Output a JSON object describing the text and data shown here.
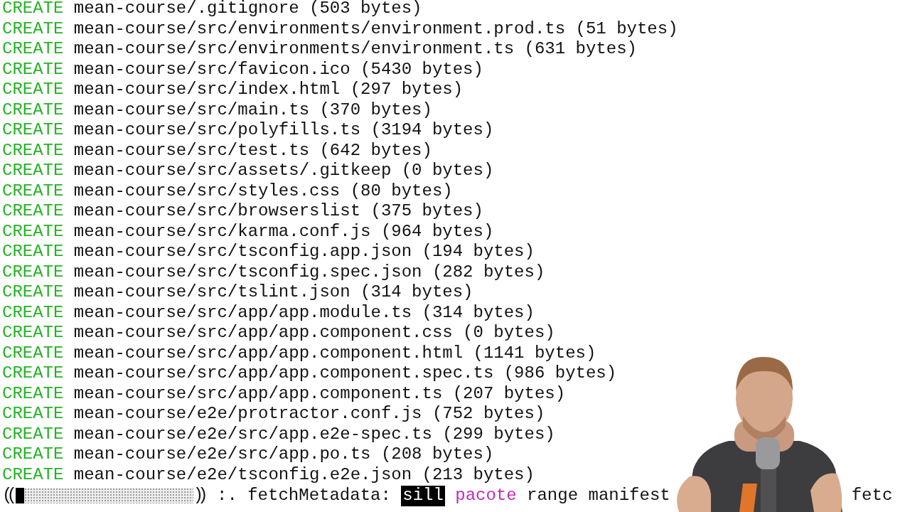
{
  "lines": [
    {
      "keyword": "CREATE",
      "text": "mean-course/.gitignore (503 bytes)"
    },
    {
      "keyword": "CREATE",
      "text": "mean-course/src/environments/environment.prod.ts (51 bytes)"
    },
    {
      "keyword": "CREATE",
      "text": "mean-course/src/environments/environment.ts (631 bytes)"
    },
    {
      "keyword": "CREATE",
      "text": "mean-course/src/favicon.ico (5430 bytes)"
    },
    {
      "keyword": "CREATE",
      "text": "mean-course/src/index.html (297 bytes)"
    },
    {
      "keyword": "CREATE",
      "text": "mean-course/src/main.ts (370 bytes)"
    },
    {
      "keyword": "CREATE",
      "text": "mean-course/src/polyfills.ts (3194 bytes)"
    },
    {
      "keyword": "CREATE",
      "text": "mean-course/src/test.ts (642 bytes)"
    },
    {
      "keyword": "CREATE",
      "text": "mean-course/src/assets/.gitkeep (0 bytes)"
    },
    {
      "keyword": "CREATE",
      "text": "mean-course/src/styles.css (80 bytes)"
    },
    {
      "keyword": "CREATE",
      "text": "mean-course/src/browserslist (375 bytes)"
    },
    {
      "keyword": "CREATE",
      "text": "mean-course/src/karma.conf.js (964 bytes)"
    },
    {
      "keyword": "CREATE",
      "text": "mean-course/src/tsconfig.app.json (194 bytes)"
    },
    {
      "keyword": "CREATE",
      "text": "mean-course/src/tsconfig.spec.json (282 bytes)"
    },
    {
      "keyword": "CREATE",
      "text": "mean-course/src/tslint.json (314 bytes)"
    },
    {
      "keyword": "CREATE",
      "text": "mean-course/src/app/app.module.ts (314 bytes)"
    },
    {
      "keyword": "CREATE",
      "text": "mean-course/src/app/app.component.css (0 bytes)"
    },
    {
      "keyword": "CREATE",
      "text": "mean-course/src/app/app.component.html (1141 bytes)"
    },
    {
      "keyword": "CREATE",
      "text": "mean-course/src/app/app.component.spec.ts (986 bytes)"
    },
    {
      "keyword": "CREATE",
      "text": "mean-course/src/app/app.component.ts (207 bytes)"
    },
    {
      "keyword": "CREATE",
      "text": "mean-course/e2e/protractor.conf.js (752 bytes)"
    },
    {
      "keyword": "CREATE",
      "text": "mean-course/e2e/src/app.e2e-spec.ts (299 bytes)"
    },
    {
      "keyword": "CREATE",
      "text": "mean-course/e2e/src/app.po.ts (208 bytes)"
    },
    {
      "keyword": "CREATE",
      "text": "mean-course/e2e/tsconfig.e2e.json (213 bytes)"
    }
  ],
  "status": {
    "open": "((",
    "level": 0.05,
    "close": "))",
    "spinner": ":.",
    "label": "fetchMetadata:",
    "log_level": "sill",
    "module": "pacote",
    "message": "range manifest",
    "tail": "fetc"
  }
}
